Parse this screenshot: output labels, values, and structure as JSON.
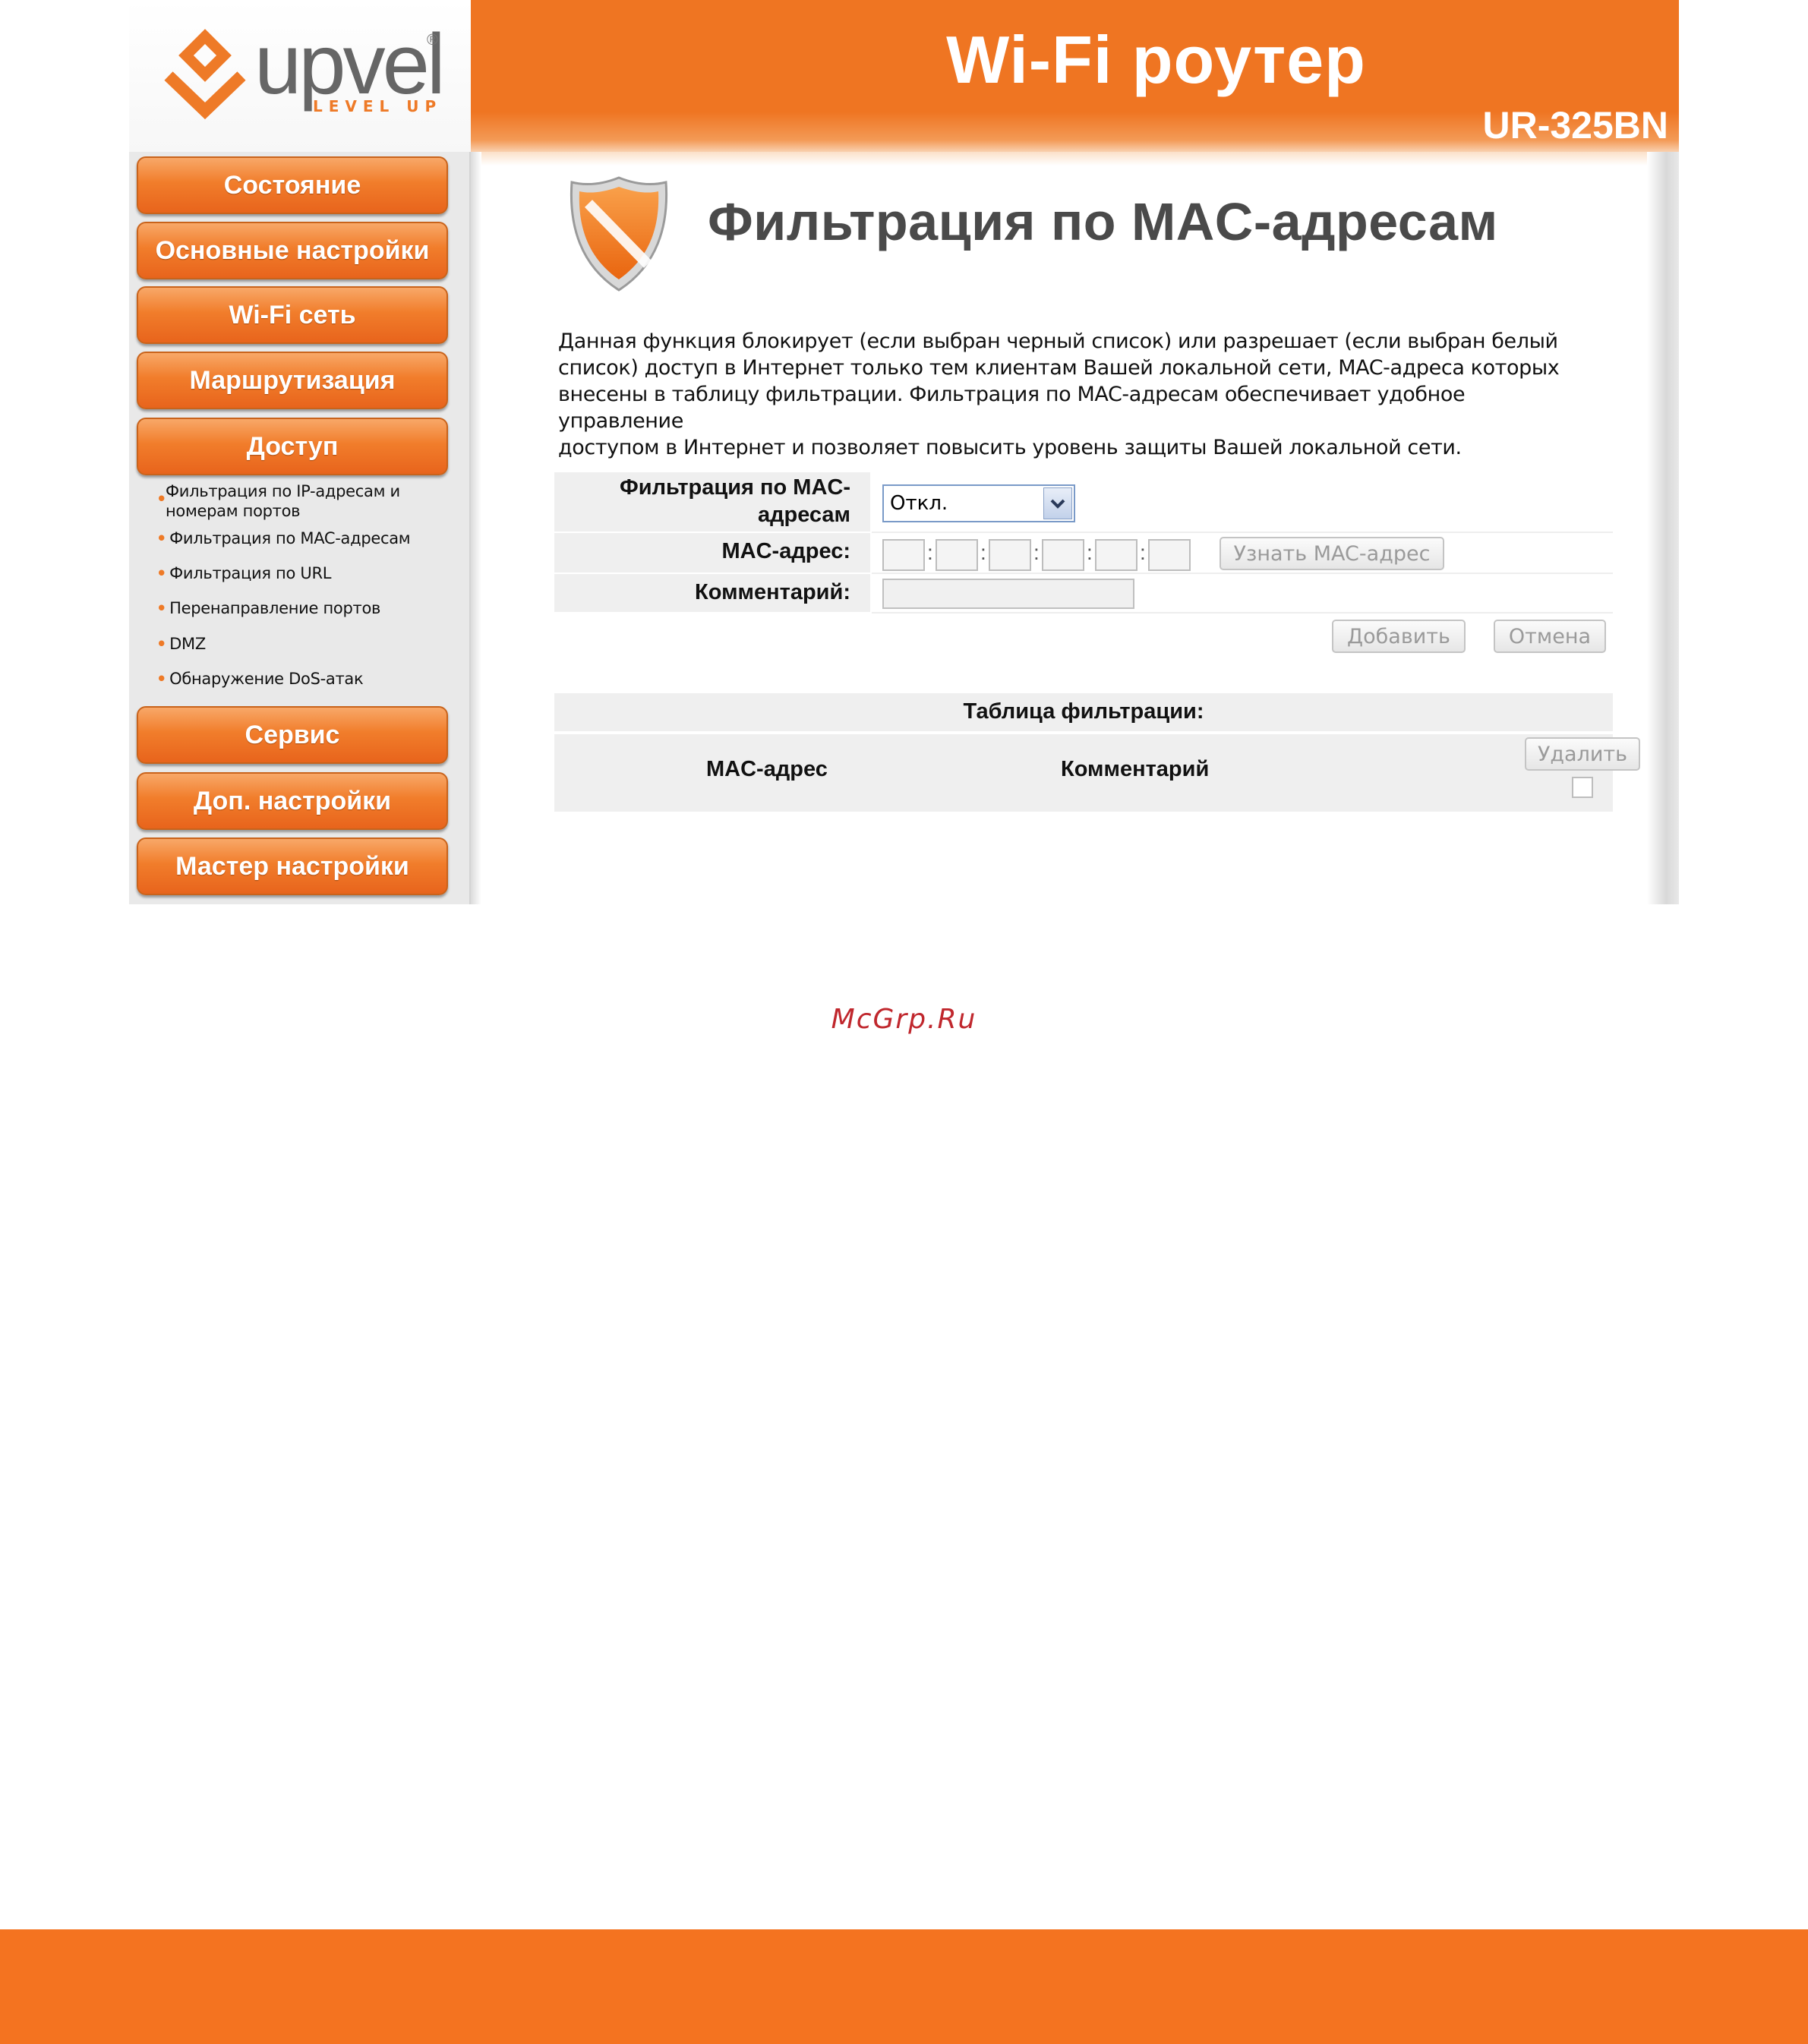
{
  "brand": {
    "logo_text": "upvel",
    "logo_reg": "®",
    "logo_tagline": "LEVEL UP",
    "accent_color": "#ef7522"
  },
  "header": {
    "title": "Wi-Fi роутер",
    "model": "UR-325BN"
  },
  "sidebar": {
    "items": [
      {
        "label": "Состояние"
      },
      {
        "label": "Основные настройки"
      },
      {
        "label": "Wi-Fi сеть"
      },
      {
        "label": "Маршрутизация"
      },
      {
        "label": "Доступ"
      },
      {
        "label": "Сервис"
      },
      {
        "label": "Доп. настройки"
      },
      {
        "label": "Мастер настройки"
      }
    ],
    "sub_items": [
      {
        "line1": "Фильтрация по IP-адресам и",
        "line2": "номерам портов"
      },
      {
        "label": "Фильтрация по MAC-адресам"
      },
      {
        "label": "Фильтрация по URL"
      },
      {
        "label": "Перенаправление портов"
      },
      {
        "label": "DMZ"
      },
      {
        "label": "Обнаружение DoS-атак"
      }
    ]
  },
  "page": {
    "icon": "shield-icon",
    "title": "Фильтрация по MAC-адресам",
    "description_lines": [
      "Данная функция блокирует (если выбран черный список) или разрешает (если выбран белый",
      "список) доступ в Интернет только тем клиентам Вашей локальной сети, MAC-адреса которых",
      "внесены в таблицу фильтрации. Фильтрация по MAC-адресам обеспечивает удобное управление",
      "доступом в Интернет и позволяет повысить уровень защиты Вашей локальной сети."
    ]
  },
  "form": {
    "filter_label_line1": "Фильтрация по MAC-",
    "filter_label_line2": "адресам",
    "filter_value": "Откл.",
    "mac_label": "MAC-адрес:",
    "mac_separator": ":",
    "mac_octets": [
      "",
      "",
      "",
      "",
      "",
      ""
    ],
    "learn_mac_button": "Узнать MAC-адрес",
    "comment_label": "Комментарий:",
    "comment_value": "",
    "add_button": "Добавить",
    "cancel_button": "Отмена"
  },
  "table": {
    "title": "Таблица фильтрации:",
    "columns": [
      "MAC-адрес",
      "Комментарий"
    ],
    "delete_button": "Удалить"
  },
  "watermark": "McGrp.Ru"
}
